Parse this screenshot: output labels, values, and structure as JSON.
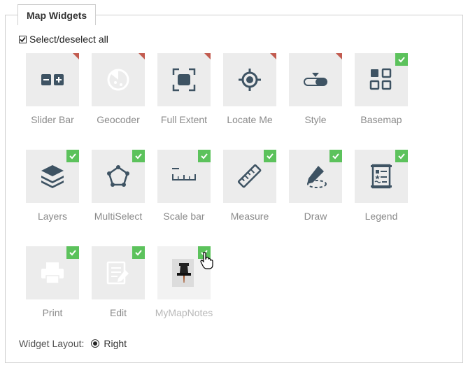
{
  "panel": {
    "title": "Map Widgets"
  },
  "select_all": {
    "label": "Select/deselect all",
    "checked": true
  },
  "colors": {
    "tile_bg": "#ececec",
    "icon_dark": "#3e5363",
    "icon_disabled": "#ffffff",
    "check_badge": "#5cc25c",
    "corner_badge": "#c25b4f"
  },
  "widgets": [
    {
      "label": "Slider Bar",
      "icon": "slider-bar-icon",
      "status": "corner"
    },
    {
      "label": "Geocoder",
      "icon": "geocoder-icon",
      "status": "corner"
    },
    {
      "label": "Full Extent",
      "icon": "full-extent-icon",
      "status": "corner"
    },
    {
      "label": "Locate Me",
      "icon": "locate-me-icon",
      "status": "corner"
    },
    {
      "label": "Style",
      "icon": "style-icon",
      "status": "corner"
    },
    {
      "label": "Basemap",
      "icon": "basemap-icon",
      "status": "checked"
    },
    {
      "label": "Layers",
      "icon": "layers-icon",
      "status": "checked"
    },
    {
      "label": "MultiSelect",
      "icon": "multiselect-icon",
      "status": "checked"
    },
    {
      "label": "Scale bar",
      "icon": "scale-bar-icon",
      "status": "checked"
    },
    {
      "label": "Measure",
      "icon": "measure-icon",
      "status": "checked"
    },
    {
      "label": "Draw",
      "icon": "draw-icon",
      "status": "checked"
    },
    {
      "label": "Legend",
      "icon": "legend-icon",
      "status": "checked"
    },
    {
      "label": "Print",
      "icon": "print-icon",
      "status": "checked"
    },
    {
      "label": "Edit",
      "icon": "edit-icon",
      "status": "checked"
    },
    {
      "label": "MyMapNotes",
      "icon": "pushpin-icon",
      "status": "checked"
    }
  ],
  "widget_layout": {
    "label": "Widget Layout:",
    "option": "Right",
    "selected": true
  }
}
